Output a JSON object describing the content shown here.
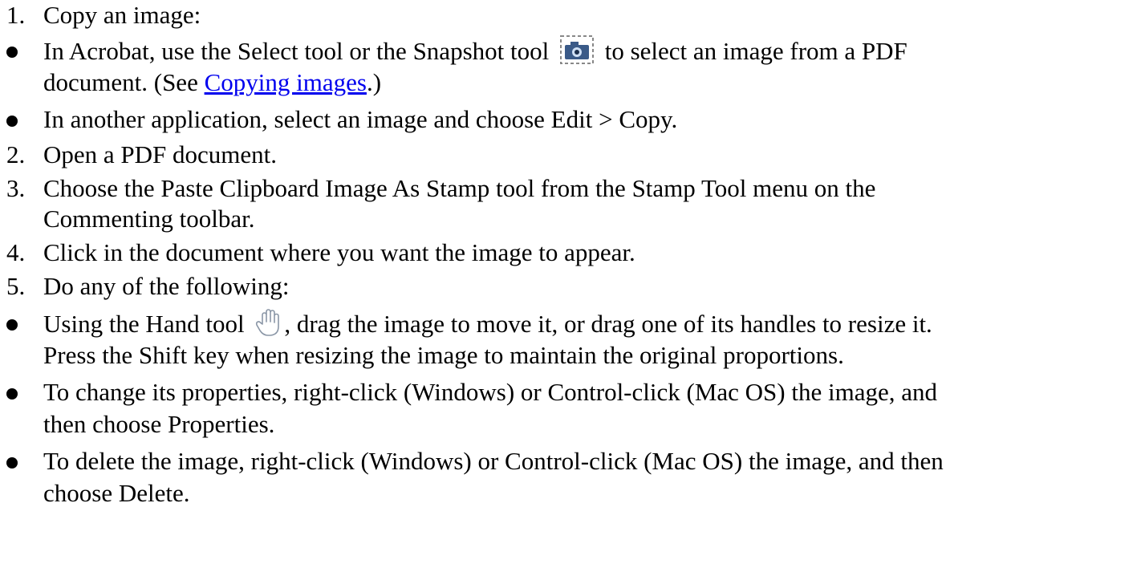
{
  "steps": [
    {
      "number": "1.",
      "text": "Copy an image:"
    },
    {
      "number": "2.",
      "text": "Open a PDF document."
    },
    {
      "number": "3.",
      "line1": "Choose the Paste Clipboard Image As Stamp tool from the Stamp Tool menu on the",
      "line2": "Commenting toolbar."
    },
    {
      "number": "4.",
      "text": "Click in the document where you want the image to appear."
    },
    {
      "number": "5.",
      "text": "Do any of the following:"
    }
  ],
  "copy_bullets": {
    "first": {
      "before_icon": "In Acrobat, use the Select tool or the Snapshot tool",
      "icon": "snapshot-camera-icon",
      "after_icon": "to select an image from a PDF",
      "line2_before_link": "document. (See ",
      "link_text": "Copying images",
      "line2_after_link": ".)"
    },
    "second": "In another application, select an image and choose Edit > Copy."
  },
  "action_bullets": {
    "hand": {
      "before_icon": "Using the Hand tool",
      "icon": "hand-tool-icon",
      "after_icon": ", drag the image to move it, or drag one of its handles to resize it.",
      "line2": "Press the Shift key when resizing the image to maintain the original proportions."
    },
    "properties": {
      "line1": "To change its properties, right-click (Windows) or Control-click (Mac OS) the image, and",
      "line2": "then choose Properties."
    },
    "delete": {
      "line1": "To delete the image, right-click (Windows) or Control-click (Mac OS) the image, and then",
      "line2": "choose Delete."
    }
  },
  "colors": {
    "link": "#0000ee",
    "text": "#000000"
  }
}
